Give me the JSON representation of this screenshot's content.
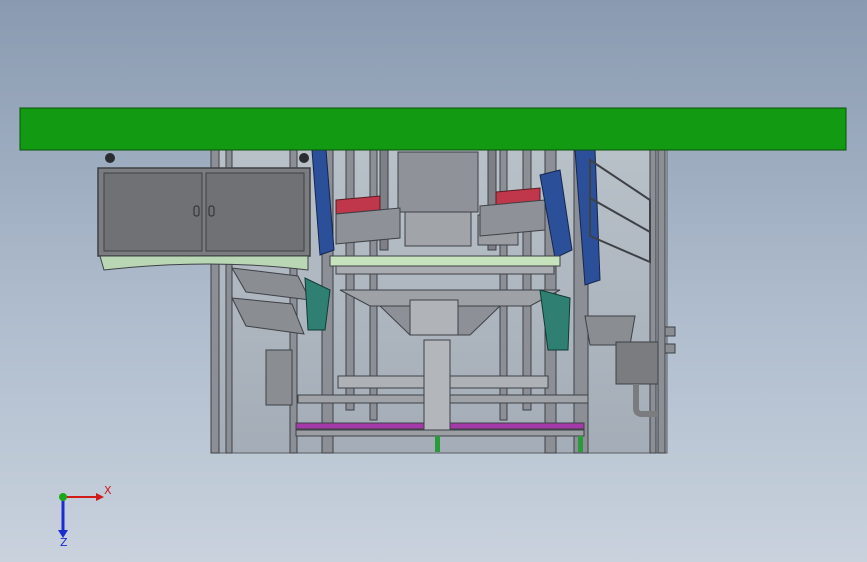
{
  "viewport": {
    "background_top": "#8a9ab0",
    "background_bottom": "#c9d2dd",
    "colors": {
      "roof": "#129b12",
      "frame": "#6b6e72",
      "cabinet": "#7a7c7f",
      "cabinet_base": "#b9d7b4",
      "robot_teal": "#2f7f72",
      "robot_blue": "#2c4f9a",
      "accent_red": "#c0364a",
      "accent_magenta": "#a33aa8",
      "light_green": "#c7e3bd"
    }
  },
  "triad": {
    "x_label": "X",
    "z_label": "Z",
    "x_color": "#d11a1a",
    "y_color": "#1aa81a",
    "z_color": "#1a2bd1"
  }
}
